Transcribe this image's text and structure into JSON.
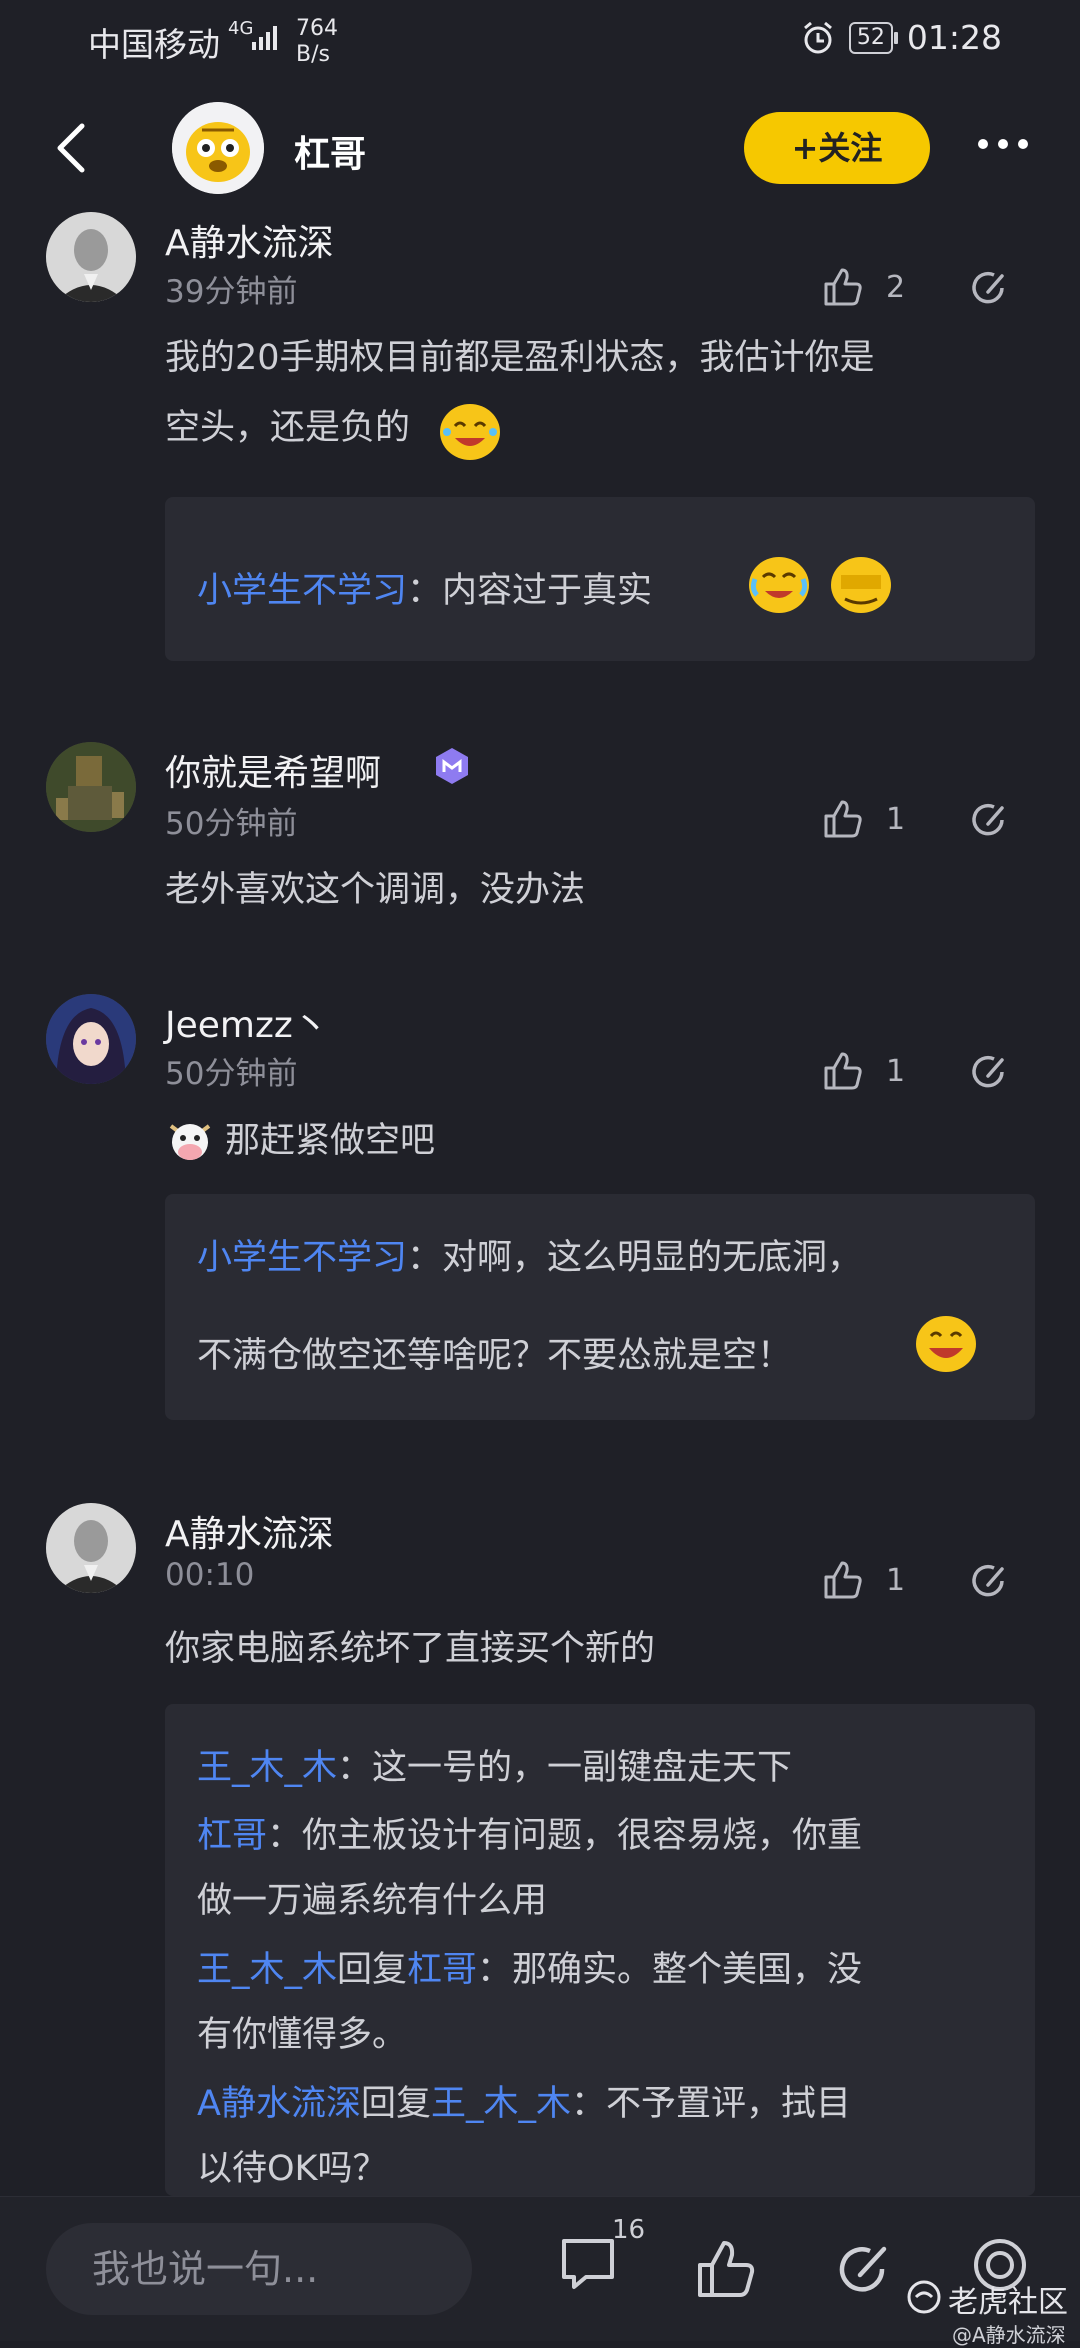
{
  "status_bar": {
    "carrier": "中国移动",
    "signal": "4G",
    "net_speed": "764",
    "net_unit": "B/s",
    "battery": "52",
    "time": "01:28"
  },
  "header": {
    "title": "杠哥",
    "follow_label": "+关注"
  },
  "comments": [
    {
      "name": "A静水流深",
      "time": "39分钟前",
      "likes": "2",
      "text_line1": "我的20手期权目前都是盈利状态，我估计你是",
      "text_line2": "空头，还是负的",
      "quote": {
        "name": "小学生不学习",
        "text": "：内容过于真实"
      }
    },
    {
      "name": "你就是希望啊",
      "time": "50分钟前",
      "likes": "1",
      "text": "老外喜欢这个调调，没办法"
    },
    {
      "name": "Jeemzz丶",
      "time": "50分钟前",
      "likes": "1",
      "text": "那赶紧做空吧",
      "quote": {
        "name": "小学生不学习",
        "text1": "：对啊，这么明显的无底洞，",
        "text2": "不满仓做空还等啥呢？不要怂就是空！"
      }
    },
    {
      "name": "A静水流深",
      "time": "00:10",
      "likes": "1",
      "text": "你家电脑系统坏了直接买个新的",
      "replies": [
        {
          "name": "王_木_木",
          "text": "：这一号的，一副键盘走天下"
        },
        {
          "name": "杠哥",
          "text1": "：你主板设计有问题，很容易烧，你重",
          "text2": "做一万遍系统有什么用"
        },
        {
          "name": "王_木_木",
          "reply_word": "回复",
          "target": "杠哥",
          "text1": "：那确实。整个美国，没",
          "text2": "有你懂得多。"
        },
        {
          "name": "A静水流深",
          "reply_word": "回复",
          "target": "王_木_木",
          "text1": "：不予置评，拭目",
          "text2": "以待OK吗？"
        }
      ]
    }
  ],
  "bottom_bar": {
    "input_placeholder": "我也说一句...",
    "comment_count": "16",
    "watermark": "老虎社区",
    "watermark_user": "@A静水流深"
  }
}
